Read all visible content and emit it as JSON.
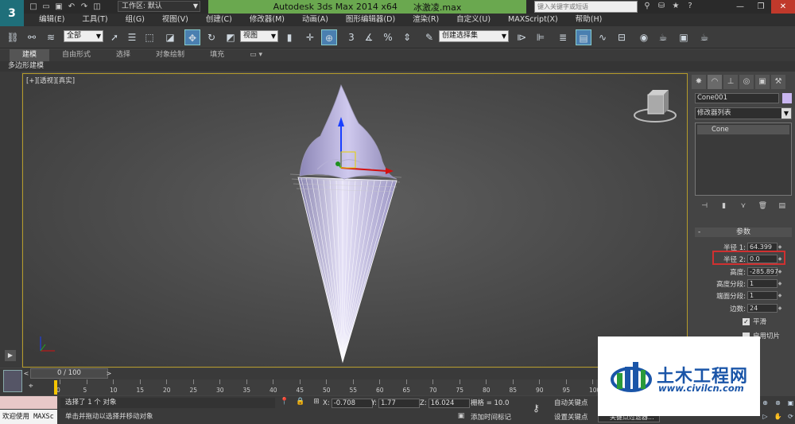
{
  "window": {
    "app_title": "Autodesk 3ds Max  2014 x64",
    "file_name": "冰激凌.max",
    "workspace": "工作区: 默认",
    "search_placeholder": "键入关键字或短语"
  },
  "menu": [
    "编辑(E)",
    "工具(T)",
    "组(G)",
    "视图(V)",
    "创建(C)",
    "修改器(M)",
    "动画(A)",
    "图形编辑器(D)",
    "渲染(R)",
    "自定义(U)",
    "MAXScript(X)",
    "帮助(H)"
  ],
  "toolbar": {
    "selection_filter": "全部",
    "ref_coord": "视图",
    "named_selection": "创建选择集"
  },
  "ribbon": {
    "tabs": [
      "建模",
      "自由形式",
      "选择",
      "对象绘制",
      "填充"
    ],
    "sub_label": "多边形建模"
  },
  "viewport": {
    "label": "[+][透视][真实]"
  },
  "command_panel": {
    "object_name": "Cone001",
    "object_color": "#c9b6f0",
    "modifier_list": "修改器列表",
    "stack_item": "Cone",
    "rollout": "参数",
    "params": [
      {
        "label": "半径 1:",
        "value": "64.399"
      },
      {
        "label": "半径 2:",
        "value": "0.0"
      },
      {
        "label": "高度:",
        "value": "-285.897"
      },
      {
        "label": "高度分段:",
        "value": "1"
      },
      {
        "label": "端面分段:",
        "value": "1"
      },
      {
        "label": "边数:",
        "value": "24"
      }
    ],
    "smooth_label": "平滑",
    "slice_label": "启用切片"
  },
  "timeline": {
    "frame": "0 / 100",
    "ticks": [
      "0",
      "5",
      "10",
      "15",
      "20",
      "25",
      "30",
      "35",
      "40",
      "45",
      "50",
      "55",
      "60",
      "65",
      "70",
      "75",
      "80",
      "85",
      "90",
      "95",
      "100"
    ]
  },
  "status": {
    "welcome": "欢迎使用 MAXSc",
    "selected": "选择了 1 个 对象",
    "prompt": "单击并拖动以选择并移动对象",
    "x_value": "-0.708",
    "y_value": "1.77",
    "z_value": "16.024",
    "x_label": "X:",
    "y_label": "Y:",
    "z_label": "Z:",
    "grid": "栅格 = 10.0",
    "add_time_tag": "添加时间标记",
    "auto_key": "自动关键点",
    "set_key": "设置关键点",
    "key_filter": "关键点过滤器..."
  },
  "watermark": {
    "name": "土木工程网",
    "url": "www.civilcn.com"
  }
}
